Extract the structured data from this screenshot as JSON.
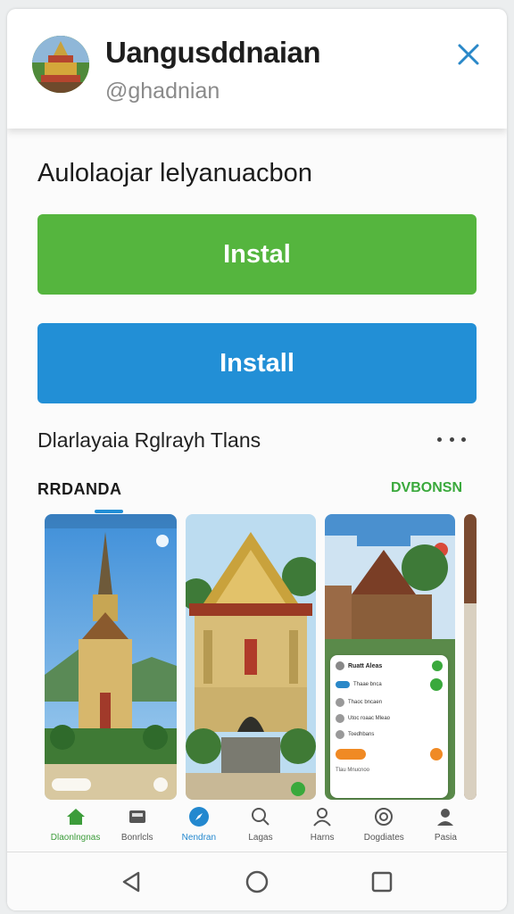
{
  "header": {
    "app_name": "Uangusddnaian",
    "handle": "@ghadnian"
  },
  "main": {
    "section_title": "Aulolaojar lelyanuacbon",
    "install_primary_label": "Instal",
    "install_secondary_label": "Install"
  },
  "screenshots": {
    "title": "Dlarlayaia Rglrayh Tlans",
    "label_left": "RRDANDA",
    "label_right": "DVBONSN",
    "shot3_card": {
      "title": "Ruatt Aleas",
      "rows": [
        "Thaae bnca",
        "Thaoc bncaen",
        "Utoc roaac Mleao",
        "Toedhbans"
      ],
      "footer": "Tlau Mnucnoo"
    }
  },
  "tabbar": [
    {
      "label": "Dlaonlngnas",
      "icon": "home-icon",
      "state": "green"
    },
    {
      "label": "Bonrlcls",
      "icon": "inbox-icon",
      "state": ""
    },
    {
      "label": "Nendran",
      "icon": "compass-icon",
      "state": "blue"
    },
    {
      "label": "Lagas",
      "icon": "search-icon",
      "state": ""
    },
    {
      "label": "Harns",
      "icon": "person-icon",
      "state": ""
    },
    {
      "label": "Dogdiates",
      "icon": "at-icon",
      "state": ""
    },
    {
      "label": "Pasia",
      "icon": "profile-icon",
      "state": ""
    }
  ],
  "colors": {
    "install_green": "#55b53e",
    "install_blue": "#228fd6",
    "close_blue": "#2a88c8",
    "accent_green": "#3aa93c"
  }
}
